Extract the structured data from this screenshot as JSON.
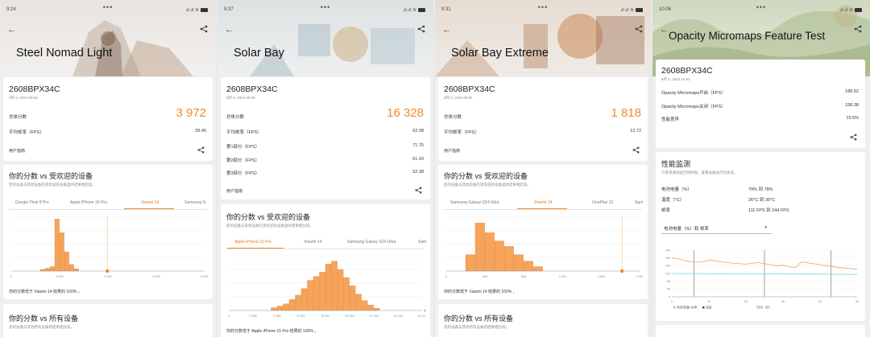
{
  "screens": [
    {
      "status_time": "9:24",
      "title": "Steel Nomad Light",
      "device": "2608BPX34C",
      "date": "9月 9, 2024 09:34",
      "overall_label": "总体分数",
      "overall_score": "3 972",
      "rows": [
        {
          "label": "平均帧率（FPS）",
          "value": "29.45"
        }
      ],
      "guide": "用户指南",
      "compare_title": "你的分数 vs 受欢迎的设备",
      "compare_sub": "您的设备与其他设备在受欢迎的设备里的结果相比较。",
      "tabs": [
        "Google Pixel 8 Pro",
        "Apple iPhone 16 Pro",
        "Xiaomi 14",
        "Samsung G"
      ],
      "active_tab": 2,
      "x_ticks": [
        "0",
        "2 000",
        "4 000",
        "6 000",
        "8 000"
      ],
      "footnote": "你的分数低于 Xiaomi 14 结果的 100% 。",
      "all_title": "你的分数 vs 所有设备",
      "all_sub": "您的设备与其他所有设备的结果相比较。"
    },
    {
      "status_time": "9:37",
      "title": "Solar Bay",
      "device": "2608BPX34C",
      "date": "9月 9, 2024 09:36",
      "overall_label": "总体分数",
      "overall_score": "16 328",
      "rows": [
        {
          "label": "平均帧率（FPS）",
          "value": "62.08"
        },
        {
          "label": "第1部分（FPS）",
          "value": "71.75"
        },
        {
          "label": "第2部分（FPS）",
          "value": "61.43"
        },
        {
          "label": "第3部分（FPS）",
          "value": "52.38"
        }
      ],
      "guide": "用户指南",
      "compare_title": "你的分数 vs 受欢迎的设备",
      "compare_sub": "您的设备与其他设备在受欢迎的设备里的结果相比较。",
      "tabs": [
        "Apple iPhone 15 Pro",
        "Xiaomi 14",
        "Samsung Galaxy S24 Ultra",
        "Sam"
      ],
      "active_tab": 0,
      "x_ticks": [
        "0",
        "2 000",
        "4 000",
        "6 000",
        "8 000",
        "10 000",
        "12 000",
        "14 000",
        "16 000"
      ],
      "footnote": "你的分数低于 Apple iPhone 15 Pro 结果的 100% 。"
    },
    {
      "status_time": "9:31",
      "title": "Solar Bay Extreme",
      "device": "2608BPX34C",
      "date": "9月 9, 2024 09:31",
      "overall_label": "总体分数",
      "overall_score": "1 818",
      "rows": [
        {
          "label": "平均帧率（FPS）",
          "value": "12.72"
        }
      ],
      "guide": "用户指南",
      "compare_title": "你的分数 vs 受欢迎的设备",
      "compare_sub": "您的设备与其他设备在受欢迎的设备里的结果相比较。",
      "tabs": [
        "Samsung Galaxy S24 Ultra",
        "Xiaomi 14",
        "OnePlus 12",
        "Sam"
      ],
      "active_tab": 1,
      "x_ticks": [
        "0",
        "400",
        "800",
        "1 200",
        "1 600",
        "2 000"
      ],
      "footnote": "你的分数低于 Xiaomi 14 结果的 100% 。",
      "all_title": "你的分数 vs 所有设备",
      "all_sub": "您的设备与其他所有设备的结果相比较。"
    },
    {
      "status_time": "10:06",
      "title": "Opacity Micromaps Feature Test",
      "device": "2608BPX34C",
      "date": "9月 9, 2024 10:01",
      "rows": [
        {
          "label": "Opacity Micromaps开启（FPS）",
          "value": "189.52"
        },
        {
          "label": "Opacity Micromaps关闭（FPS）",
          "value": "158.38"
        },
        {
          "label": "性能差异",
          "value": "19.5%"
        }
      ],
      "perf_title": "性能监测",
      "perf_sub": "只要求测试运行的时候，查看设备运行的状况。",
      "perf_rows": [
        {
          "label": "电池电量（%）",
          "value": "79% 到 78%"
        },
        {
          "label": "温度（°C）",
          "value": "26°C 到 36°C"
        },
        {
          "label": "帧率",
          "value": "111 FPS 到 244 FPS"
        }
      ],
      "select_value": "电池电量（%）和 帧率",
      "y_ticks": [
        "240",
        "200",
        "160",
        "120",
        "80",
        "40",
        "0"
      ],
      "x_ticks": [
        "0",
        "10",
        "20",
        "30",
        "40",
        "50"
      ],
      "legend": [
        "电池电量",
        "帧率",
        "温度"
      ],
      "axis_label": "时间（秒）"
    }
  ],
  "colors": {
    "accent": "#f08a2a",
    "bar": "#f6a35c",
    "battery_line": "#7fd3e8"
  },
  "chart_data": [
    {
      "type": "bar",
      "title": "",
      "x": [
        1200,
        1400,
        1600,
        1800,
        2000,
        2200,
        2400,
        2600
      ],
      "values": [
        3,
        5,
        8,
        95,
        70,
        35,
        12,
        4
      ],
      "xlim": [
        0,
        8000
      ],
      "ylim": [
        0,
        100
      ],
      "marker": 3972
    },
    {
      "type": "bar",
      "title": "",
      "x": [
        3500,
        4000,
        4500,
        5000,
        5500,
        6000,
        6500,
        7000,
        7500,
        8000,
        8500,
        9000,
        9500,
        10000,
        10500,
        11000,
        11500,
        12000
      ],
      "values": [
        5,
        8,
        12,
        20,
        28,
        40,
        55,
        62,
        70,
        85,
        90,
        75,
        60,
        45,
        30,
        18,
        10,
        4
      ],
      "xlim": [
        0,
        16000
      ],
      "ylim": [
        0,
        100
      ],
      "marker": 16328
    },
    {
      "type": "bar",
      "title": "",
      "x": [
        200,
        300,
        400,
        500,
        600,
        700,
        800,
        900
      ],
      "values": [
        30,
        88,
        70,
        55,
        45,
        30,
        18,
        8
      ],
      "xlim": [
        0,
        2000
      ],
      "ylim": [
        0,
        100
      ],
      "marker": 1818
    },
    {
      "type": "line",
      "title": "",
      "xlabel": "时间（秒）",
      "ylim": [
        0,
        240
      ],
      "xlim": [
        0,
        60
      ],
      "series": [
        {
          "name": "帧率",
          "x": [
            0,
            2,
            4,
            6,
            8,
            10,
            12,
            14,
            16,
            18,
            20,
            22,
            24,
            26,
            28,
            30,
            32,
            34,
            36,
            38,
            40,
            42,
            44,
            46,
            48,
            50,
            52,
            54,
            56,
            58,
            60
          ],
          "values": [
            200,
            196,
            188,
            182,
            178,
            180,
            190,
            185,
            180,
            176,
            172,
            170,
            168,
            172,
            176,
            170,
            165,
            160,
            162,
            155,
            150,
            180,
            175,
            170,
            165,
            160,
            156,
            150,
            148,
            145,
            142
          ]
        },
        {
          "name": "电池电量",
          "x": [
            0,
            10,
            20,
            30,
            40,
            50,
            60
          ],
          "values": [
            120,
            119,
            118,
            118,
            117,
            116,
            115
          ]
        }
      ]
    }
  ]
}
